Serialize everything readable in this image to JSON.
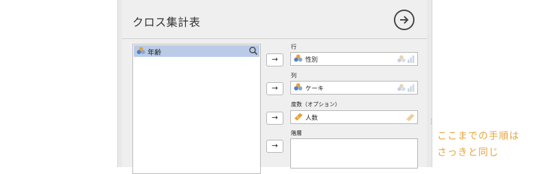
{
  "title": "クロス集計表",
  "run_button_icon": "arrow-circle-right-icon",
  "source": {
    "items": [
      {
        "label": "年齢",
        "icon": "nominal-variable-icon"
      }
    ],
    "search_icon": "search-icon"
  },
  "targets": [
    {
      "label": "行",
      "value": "性別",
      "arrow": "→"
    },
    {
      "label": "列",
      "value": "ケーキ",
      "arrow": "→"
    },
    {
      "label": "度数（オプション）",
      "value": "人数",
      "arrow": "→"
    },
    {
      "label": "階層",
      "value": "",
      "arrow": "→"
    }
  ],
  "annotation": {
    "line1": "ここまでの手順は",
    "line2": "さっきと同じ",
    "color": "#e8a43c"
  },
  "colors": {
    "selected_row": "#b9cbe7",
    "panel_bg": "#efefef"
  }
}
